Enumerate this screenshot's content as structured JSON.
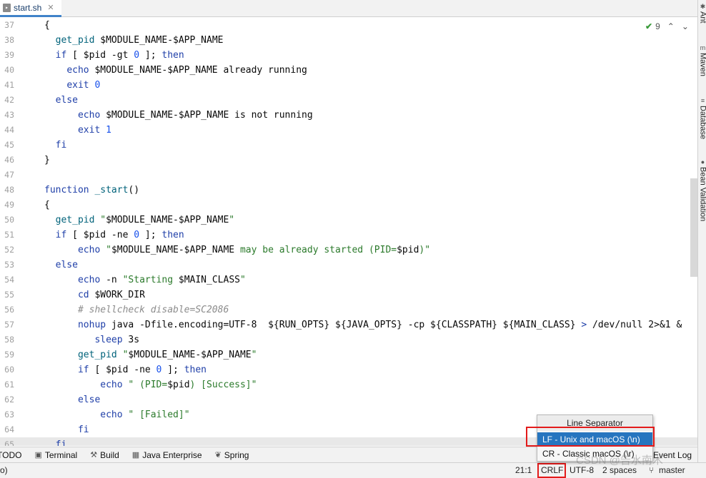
{
  "tab": {
    "label": "start.sh",
    "icon": "shell-file-icon",
    "close_glyph": "✕"
  },
  "inspection": {
    "count": "9"
  },
  "right_tools": [
    {
      "label": "Ant",
      "icon": "ant-icon"
    },
    {
      "label": "Maven",
      "icon": "maven-icon"
    },
    {
      "label": "Database",
      "icon": "database-icon"
    },
    {
      "label": "Bean Validation",
      "icon": "bean-validation-icon"
    }
  ],
  "code_lines": [
    {
      "n": "37",
      "html": "{"
    },
    {
      "n": "38",
      "html": "  <span class=\"fn\">get_pid</span> $MODULE_NAME-$APP_NAME"
    },
    {
      "n": "39",
      "html": "  <span class=\"kw\">if</span> [ $pid -gt <span class=\"num\">0</span> ]; <span class=\"kw\">then</span>"
    },
    {
      "n": "40",
      "html": "    <span class=\"kw\">echo</span> $MODULE_NAME-$APP_NAME already running"
    },
    {
      "n": "41",
      "html": "    <span class=\"kw\">exit</span> <span class=\"num\">0</span>"
    },
    {
      "n": "42",
      "html": "  <span class=\"kw\">else</span>"
    },
    {
      "n": "43",
      "html": "      <span class=\"kw\">echo</span> $MODULE_NAME-$APP_NAME is not running"
    },
    {
      "n": "44",
      "html": "      <span class=\"kw\">exit</span> <span class=\"num\">1</span>"
    },
    {
      "n": "45",
      "html": "  <span class=\"kw\">fi</span>"
    },
    {
      "n": "46",
      "html": "}"
    },
    {
      "n": "47",
      "html": ""
    },
    {
      "n": "48",
      "html": "<span class=\"kw\">function</span> <span class=\"fn\">_start</span>()"
    },
    {
      "n": "49",
      "html": "{"
    },
    {
      "n": "50",
      "html": "  <span class=\"fn\">get_pid</span> <span class=\"str\">\"</span>$MODULE_NAME-$APP_NAME<span class=\"str\">\"</span>"
    },
    {
      "n": "51",
      "html": "  <span class=\"kw\">if</span> [ $pid -ne <span class=\"num\">0</span> ]; <span class=\"kw\">then</span>"
    },
    {
      "n": "52",
      "html": "      <span class=\"kw\">echo</span> <span class=\"str\">\"</span>$MODULE_NAME-$APP_NAME<span class=\"str\"> may be already started (PID=</span>$pid<span class=\"str\">)\"</span>"
    },
    {
      "n": "53",
      "html": "  <span class=\"kw\">else</span>"
    },
    {
      "n": "54",
      "html": "      <span class=\"kw\">echo</span> -n <span class=\"str\">\"Starting </span>$MAIN_CLASS<span class=\"str\">\"</span>"
    },
    {
      "n": "55",
      "html": "      <span class=\"kw\">cd</span> $WORK_DIR"
    },
    {
      "n": "56",
      "html": "      <span class=\"cmt\"># shellcheck disable=SC2086</span>"
    },
    {
      "n": "57",
      "html": "      <span class=\"kw\">nohup</span> java -Dfile.encoding=UTF-8  ${RUN_OPTS} ${JAVA_OPTS} -cp ${CLASSPATH} ${MAIN_CLASS} <span class=\"kw\">&gt;</span> /dev/null 2&gt;&amp;1 &amp;"
    },
    {
      "n": "58",
      "html": "         <span class=\"kw\">sleep</span> 3s"
    },
    {
      "n": "59",
      "html": "      <span class=\"fn\">get_pid</span> <span class=\"str\">\"</span>$MODULE_NAME-$APP_NAME<span class=\"str\">\"</span>"
    },
    {
      "n": "60",
      "html": "      <span class=\"kw\">if</span> [ $pid -ne <span class=\"num\">0</span> ]; <span class=\"kw\">then</span>"
    },
    {
      "n": "61",
      "html": "          <span class=\"kw\">echo</span> <span class=\"str\">\" (PID=</span>$pid<span class=\"str\">) [Success]\"</span>"
    },
    {
      "n": "62",
      "html": "      <span class=\"kw\">else</span>"
    },
    {
      "n": "63",
      "html": "          <span class=\"kw\">echo</span> <span class=\"str\">\" [Failed]\"</span>"
    },
    {
      "n": "64",
      "html": "      <span class=\"kw\">fi</span>"
    },
    {
      "n": "65",
      "html": "  <span class=\"kw\">fi</span>"
    }
  ],
  "tool_windows": [
    {
      "label": "TODO",
      "icon": "todo-icon"
    },
    {
      "label": "Terminal",
      "icon": "terminal-icon"
    },
    {
      "label": "Build",
      "icon": "hammer-icon"
    },
    {
      "label": "Java Enterprise",
      "icon": "java-enterprise-icon"
    },
    {
      "label": "Spring",
      "icon": "spring-icon"
    }
  ],
  "event_log": "Event Log",
  "status": {
    "left_fragment": "o)",
    "position": "21:1",
    "line_separator": "CRLF",
    "encoding": "UTF-8",
    "indent": "2 spaces",
    "branch": "master"
  },
  "popup": {
    "title": "Line Separator",
    "options": [
      {
        "label": "LF - Unix and macOS (\\n)",
        "selected": true
      },
      {
        "label": "CR - Classic macOS (\\r)",
        "selected": false
      }
    ]
  },
  "watermark": "CSDN @告水南木",
  "colors": {
    "accent": "#2675bf",
    "highlight_box": "#e31b1b",
    "tab_underline": "#4083c9"
  }
}
